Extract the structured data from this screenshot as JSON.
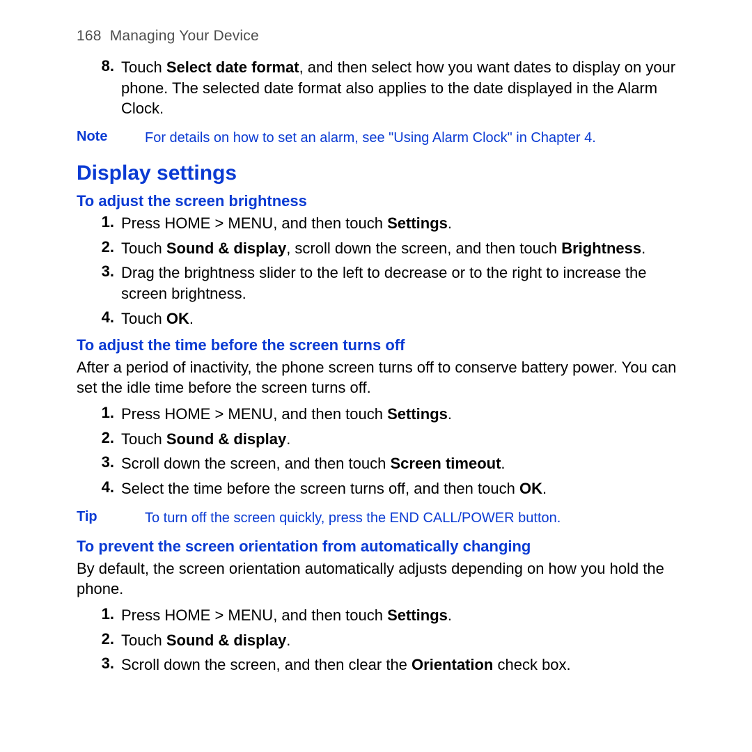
{
  "header": {
    "page_number": "168",
    "section": "Managing Your Device"
  },
  "intro_step": {
    "number": "8.",
    "prefix": "Touch ",
    "bold1": "Select date format",
    "rest": ", and then select how you want dates to display on your phone. The selected date format also applies to the date displayed in the Alarm Clock."
  },
  "note1": {
    "label": "Note",
    "text": "For details on how to set an alarm, see \"Using Alarm Clock\" in Chapter 4."
  },
  "h2": "Display settings",
  "section1": {
    "title": "To adjust the screen brightness",
    "steps": [
      {
        "n": "1.",
        "pre": "Press HOME > MENU, and then touch ",
        "b1": "Settings",
        "mid": ".",
        "b2": "",
        "post": ""
      },
      {
        "n": "2.",
        "pre": "Touch ",
        "b1": "Sound & display",
        "mid": ", scroll down the screen, and then touch ",
        "b2": "Brightness",
        "post": "."
      },
      {
        "n": "3.",
        "pre": "Drag the brightness slider to the left to decrease or to the right to increase the screen brightness.",
        "b1": "",
        "mid": "",
        "b2": "",
        "post": ""
      },
      {
        "n": "4.",
        "pre": "Touch ",
        "b1": "OK",
        "mid": ".",
        "b2": "",
        "post": ""
      }
    ]
  },
  "section2": {
    "title": "To adjust the time before the screen turns off",
    "intro": "After a period of inactivity, the phone screen turns off to conserve battery power. You can set the idle time before the screen turns off.",
    "steps": [
      {
        "n": "1.",
        "pre": "Press HOME > MENU, and then touch ",
        "b1": "Settings",
        "mid": ".",
        "b2": "",
        "post": ""
      },
      {
        "n": "2.",
        "pre": "Touch ",
        "b1": "Sound & display",
        "mid": ".",
        "b2": "",
        "post": ""
      },
      {
        "n": "3.",
        "pre": "Scroll down the screen, and then touch ",
        "b1": "Screen timeout",
        "mid": ".",
        "b2": "",
        "post": ""
      },
      {
        "n": "4.",
        "pre": "Select the time before the screen turns off, and then touch ",
        "b1": "OK",
        "mid": ".",
        "b2": "",
        "post": ""
      }
    ]
  },
  "tip1": {
    "label": "Tip",
    "text": "To turn off the screen quickly, press the END CALL/POWER button."
  },
  "section3": {
    "title": "To prevent the screen orientation from automatically changing",
    "intro": "By default, the screen orientation automatically adjusts depending on how you hold the phone.",
    "steps": [
      {
        "n": "1.",
        "pre": "Press HOME > MENU, and then touch ",
        "b1": "Settings",
        "mid": ".",
        "b2": "",
        "post": ""
      },
      {
        "n": "2.",
        "pre": "Touch ",
        "b1": "Sound & display",
        "mid": ".",
        "b2": "",
        "post": ""
      },
      {
        "n": "3.",
        "pre": "Scroll down the screen, and then clear the ",
        "b1": "Orientation",
        "mid": " check box.",
        "b2": "",
        "post": ""
      }
    ]
  }
}
